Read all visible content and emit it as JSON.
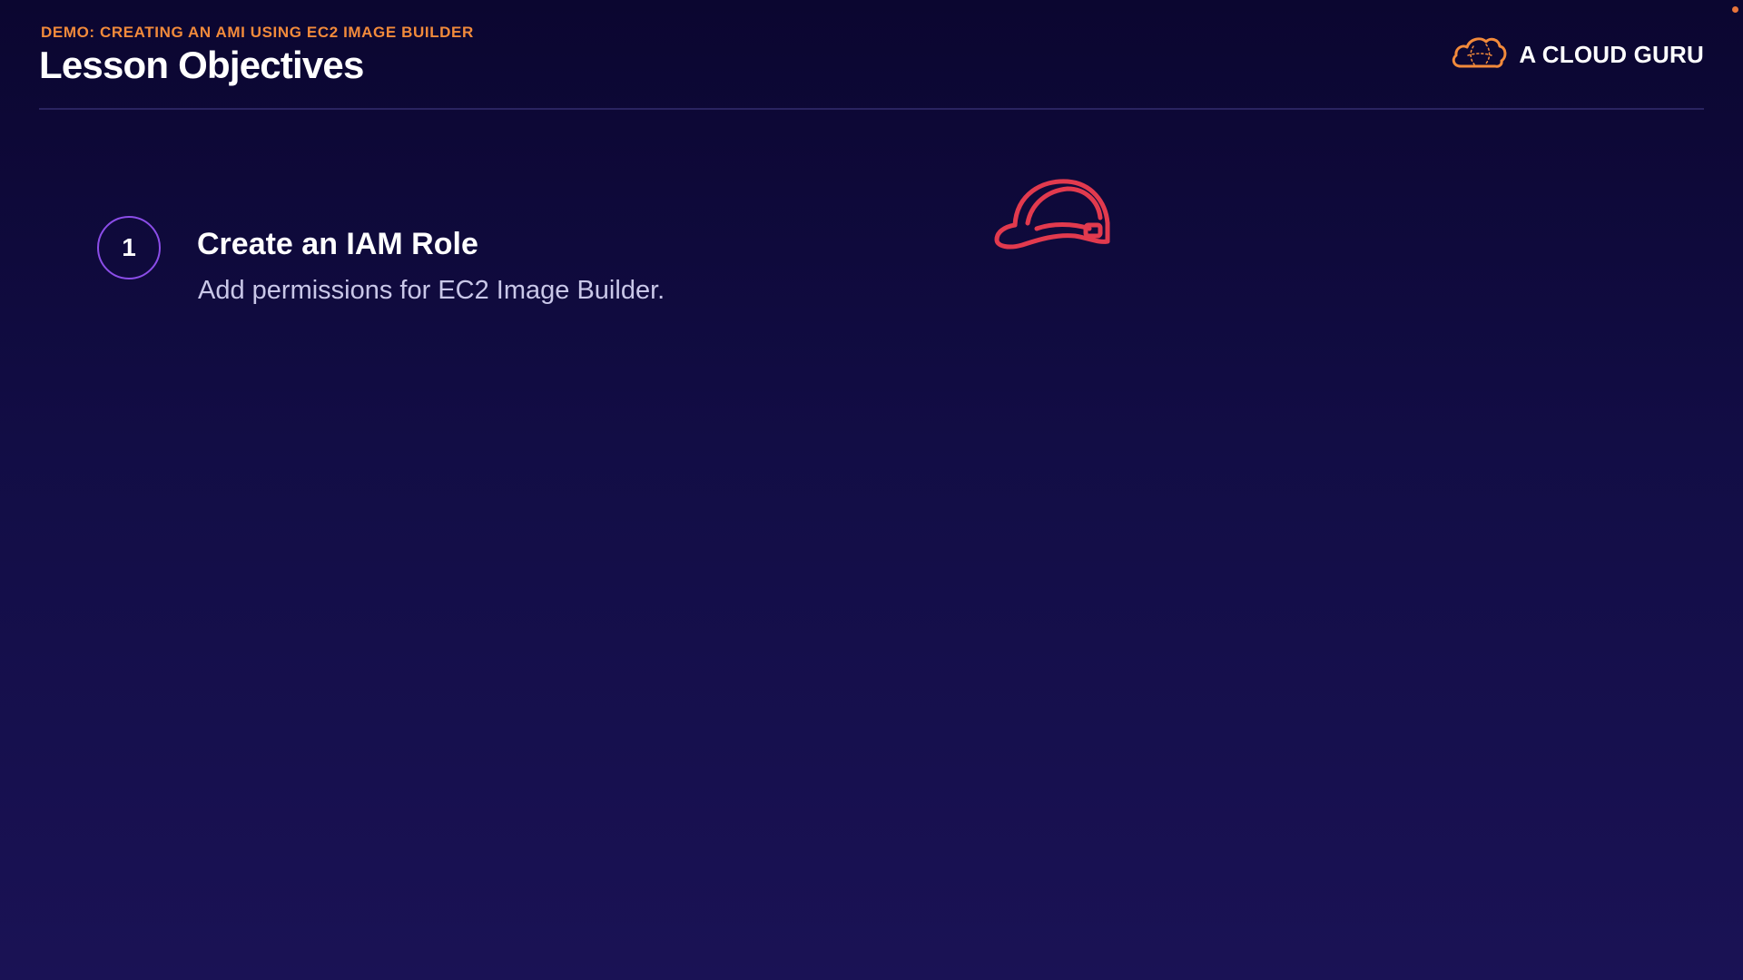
{
  "header": {
    "subtitle": "DEMO: CREATING AN AMI USING EC2 IMAGE BUILDER",
    "title": "Lesson Objectives"
  },
  "logo": {
    "text": "A CLOUD GURU",
    "icon": "cloud-icon"
  },
  "objectives": [
    {
      "number": "1",
      "title": "Create an IAM Role",
      "description": "Add permissions for EC2 Image Builder."
    }
  ],
  "illustration": {
    "icon": "hard-hat-icon"
  },
  "colors": {
    "background_top": "#0b0630",
    "background_bottom": "#1a1255",
    "accent_orange": "#f28a3b",
    "circle_purple": "#8b4de8",
    "hardhat_red": "#e23a4e",
    "description_text": "#c9c7e8"
  }
}
